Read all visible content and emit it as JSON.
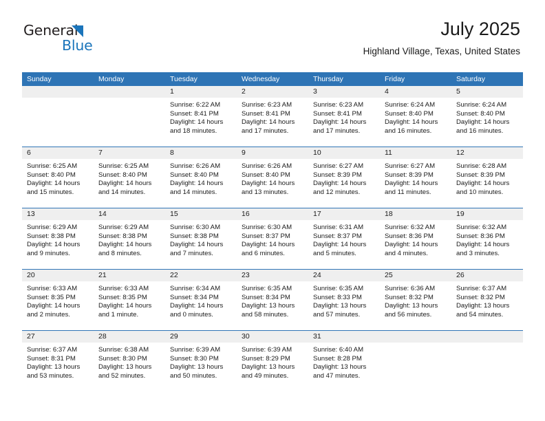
{
  "brand": {
    "name_dark": "General",
    "name_light": "Blue",
    "accent_color": "#1b75bb"
  },
  "header": {
    "title": "July 2025",
    "subtitle": "Highland Village, Texas, United States",
    "header_bg_color": "#2e74b5",
    "date_band_color": "#efefef"
  },
  "weekdays": [
    "Sunday",
    "Monday",
    "Tuesday",
    "Wednesday",
    "Thursday",
    "Friday",
    "Saturday"
  ],
  "weeks": [
    {
      "days": [
        {
          "num": "",
          "lines": []
        },
        {
          "num": "",
          "lines": []
        },
        {
          "num": "1",
          "lines": [
            "Sunrise: 6:22 AM",
            "Sunset: 8:41 PM",
            "Daylight: 14 hours",
            "and 18 minutes."
          ]
        },
        {
          "num": "2",
          "lines": [
            "Sunrise: 6:23 AM",
            "Sunset: 8:41 PM",
            "Daylight: 14 hours",
            "and 17 minutes."
          ]
        },
        {
          "num": "3",
          "lines": [
            "Sunrise: 6:23 AM",
            "Sunset: 8:41 PM",
            "Daylight: 14 hours",
            "and 17 minutes."
          ]
        },
        {
          "num": "4",
          "lines": [
            "Sunrise: 6:24 AM",
            "Sunset: 8:40 PM",
            "Daylight: 14 hours",
            "and 16 minutes."
          ]
        },
        {
          "num": "5",
          "lines": [
            "Sunrise: 6:24 AM",
            "Sunset: 8:40 PM",
            "Daylight: 14 hours",
            "and 16 minutes."
          ]
        }
      ]
    },
    {
      "days": [
        {
          "num": "6",
          "lines": [
            "Sunrise: 6:25 AM",
            "Sunset: 8:40 PM",
            "Daylight: 14 hours",
            "and 15 minutes."
          ]
        },
        {
          "num": "7",
          "lines": [
            "Sunrise: 6:25 AM",
            "Sunset: 8:40 PM",
            "Daylight: 14 hours",
            "and 14 minutes."
          ]
        },
        {
          "num": "8",
          "lines": [
            "Sunrise: 6:26 AM",
            "Sunset: 8:40 PM",
            "Daylight: 14 hours",
            "and 14 minutes."
          ]
        },
        {
          "num": "9",
          "lines": [
            "Sunrise: 6:26 AM",
            "Sunset: 8:40 PM",
            "Daylight: 14 hours",
            "and 13 minutes."
          ]
        },
        {
          "num": "10",
          "lines": [
            "Sunrise: 6:27 AM",
            "Sunset: 8:39 PM",
            "Daylight: 14 hours",
            "and 12 minutes."
          ]
        },
        {
          "num": "11",
          "lines": [
            "Sunrise: 6:27 AM",
            "Sunset: 8:39 PM",
            "Daylight: 14 hours",
            "and 11 minutes."
          ]
        },
        {
          "num": "12",
          "lines": [
            "Sunrise: 6:28 AM",
            "Sunset: 8:39 PM",
            "Daylight: 14 hours",
            "and 10 minutes."
          ]
        }
      ]
    },
    {
      "days": [
        {
          "num": "13",
          "lines": [
            "Sunrise: 6:29 AM",
            "Sunset: 8:38 PM",
            "Daylight: 14 hours",
            "and 9 minutes."
          ]
        },
        {
          "num": "14",
          "lines": [
            "Sunrise: 6:29 AM",
            "Sunset: 8:38 PM",
            "Daylight: 14 hours",
            "and 8 minutes."
          ]
        },
        {
          "num": "15",
          "lines": [
            "Sunrise: 6:30 AM",
            "Sunset: 8:38 PM",
            "Daylight: 14 hours",
            "and 7 minutes."
          ]
        },
        {
          "num": "16",
          "lines": [
            "Sunrise: 6:30 AM",
            "Sunset: 8:37 PM",
            "Daylight: 14 hours",
            "and 6 minutes."
          ]
        },
        {
          "num": "17",
          "lines": [
            "Sunrise: 6:31 AM",
            "Sunset: 8:37 PM",
            "Daylight: 14 hours",
            "and 5 minutes."
          ]
        },
        {
          "num": "18",
          "lines": [
            "Sunrise: 6:32 AM",
            "Sunset: 8:36 PM",
            "Daylight: 14 hours",
            "and 4 minutes."
          ]
        },
        {
          "num": "19",
          "lines": [
            "Sunrise: 6:32 AM",
            "Sunset: 8:36 PM",
            "Daylight: 14 hours",
            "and 3 minutes."
          ]
        }
      ]
    },
    {
      "days": [
        {
          "num": "20",
          "lines": [
            "Sunrise: 6:33 AM",
            "Sunset: 8:35 PM",
            "Daylight: 14 hours",
            "and 2 minutes."
          ]
        },
        {
          "num": "21",
          "lines": [
            "Sunrise: 6:33 AM",
            "Sunset: 8:35 PM",
            "Daylight: 14 hours",
            "and 1 minute."
          ]
        },
        {
          "num": "22",
          "lines": [
            "Sunrise: 6:34 AM",
            "Sunset: 8:34 PM",
            "Daylight: 14 hours",
            "and 0 minutes."
          ]
        },
        {
          "num": "23",
          "lines": [
            "Sunrise: 6:35 AM",
            "Sunset: 8:34 PM",
            "Daylight: 13 hours",
            "and 58 minutes."
          ]
        },
        {
          "num": "24",
          "lines": [
            "Sunrise: 6:35 AM",
            "Sunset: 8:33 PM",
            "Daylight: 13 hours",
            "and 57 minutes."
          ]
        },
        {
          "num": "25",
          "lines": [
            "Sunrise: 6:36 AM",
            "Sunset: 8:32 PM",
            "Daylight: 13 hours",
            "and 56 minutes."
          ]
        },
        {
          "num": "26",
          "lines": [
            "Sunrise: 6:37 AM",
            "Sunset: 8:32 PM",
            "Daylight: 13 hours",
            "and 54 minutes."
          ]
        }
      ]
    },
    {
      "days": [
        {
          "num": "27",
          "lines": [
            "Sunrise: 6:37 AM",
            "Sunset: 8:31 PM",
            "Daylight: 13 hours",
            "and 53 minutes."
          ]
        },
        {
          "num": "28",
          "lines": [
            "Sunrise: 6:38 AM",
            "Sunset: 8:30 PM",
            "Daylight: 13 hours",
            "and 52 minutes."
          ]
        },
        {
          "num": "29",
          "lines": [
            "Sunrise: 6:39 AM",
            "Sunset: 8:30 PM",
            "Daylight: 13 hours",
            "and 50 minutes."
          ]
        },
        {
          "num": "30",
          "lines": [
            "Sunrise: 6:39 AM",
            "Sunset: 8:29 PM",
            "Daylight: 13 hours",
            "and 49 minutes."
          ]
        },
        {
          "num": "31",
          "lines": [
            "Sunrise: 6:40 AM",
            "Sunset: 8:28 PM",
            "Daylight: 13 hours",
            "and 47 minutes."
          ]
        },
        {
          "num": "",
          "lines": []
        },
        {
          "num": "",
          "lines": []
        }
      ]
    }
  ]
}
